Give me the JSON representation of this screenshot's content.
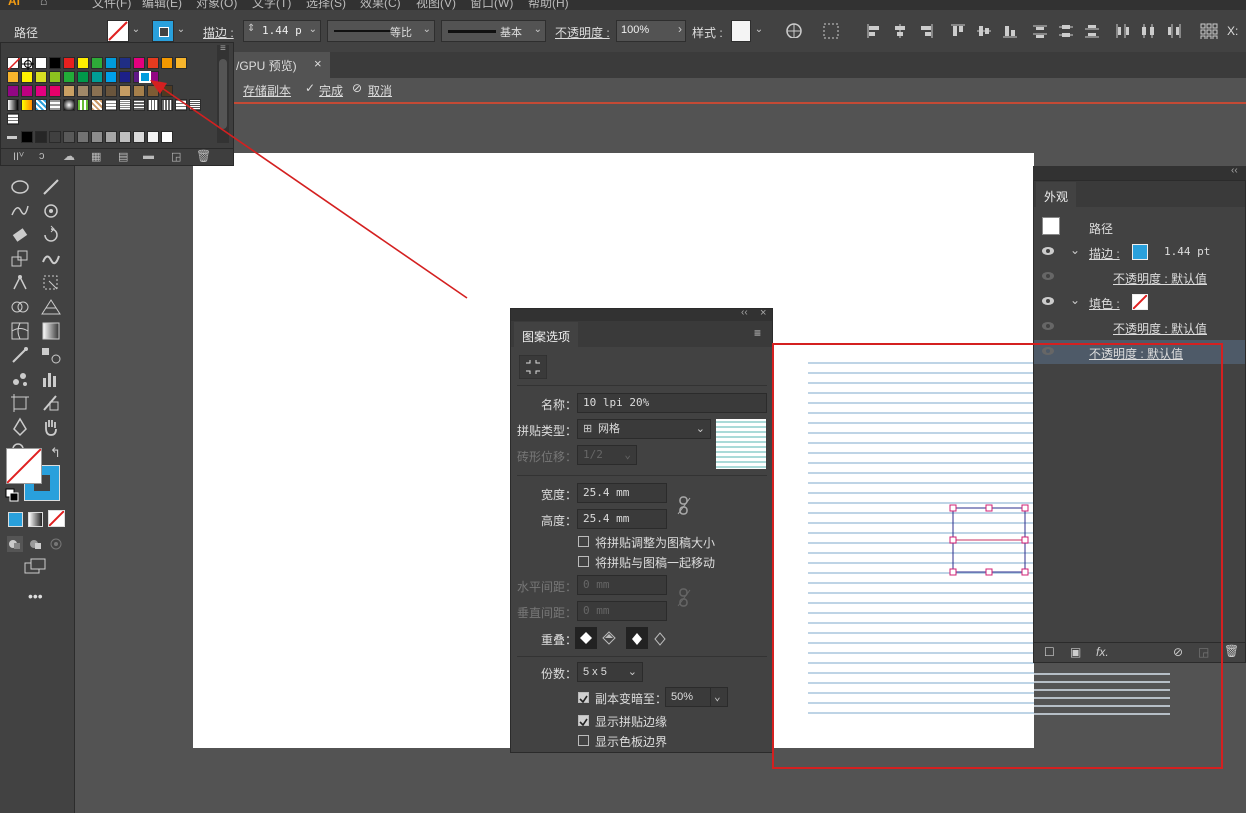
{
  "menubar": {
    "app_logo": "Ai",
    "items": [
      "文件(F)",
      "编辑(E)",
      "对象(O)",
      "文字(T)",
      "选择(S)",
      "效果(C)",
      "视图(V)",
      "窗口(W)",
      "帮助(H)"
    ]
  },
  "control_bar": {
    "selection_label": "路径",
    "stroke_label": "描边 :",
    "stroke_weight": "1.44 p",
    "profile_label": "等比",
    "brush_label": "基本",
    "opacity_label": "不透明度 :",
    "opacity_value": "100%",
    "style_label": "样式 :",
    "x_label": "X:"
  },
  "doc_tab": {
    "title": "/GPU 预览)",
    "close": "×"
  },
  "isolation_bar": {
    "save_copy": "存储副本",
    "done": "完成",
    "cancel": "取消",
    "check_glyph": "✓",
    "cancel_glyph": "⊘"
  },
  "swatches": {
    "colors_row1": [
      "#ffffff",
      "#000000",
      "#e8201f",
      "#ffed00",
      "#2eab38",
      "#009cdc",
      "#1f2e84",
      "#e5007e",
      "#e63b1f",
      "#f39800",
      "#f7b52c"
    ],
    "colors_row2": [
      "#f7b52c",
      "#fff100",
      "#d7df22",
      "#8dc21f",
      "#22ac38",
      "#00984a",
      "#009e96",
      "#00a0e9",
      "#1d2088",
      "#5f1985",
      "#920783"
    ],
    "colors_row3": [
      "#920783",
      "#be0081",
      "#e4007f",
      "#e5006a",
      "#c9a063",
      "#a08868",
      "#8a7152",
      "#6a553c",
      "#c59c63",
      "#a57f4b",
      "#7d5b34",
      "#4f3a22"
    ],
    "grays": [
      "#000000",
      "#262626",
      "#404040",
      "#595959",
      "#737373",
      "#8c8c8c",
      "#a6a6a6",
      "#bfbfbf",
      "#d9d9d9",
      "#f2f2f2",
      "#ffffff"
    ],
    "selected_color": "#009cdc"
  },
  "pattern_panel": {
    "title": "图案选项",
    "name_label": "名称：",
    "name_value": "10 lpi 20%",
    "tile_type_label": "拼贴类型：",
    "tile_type_value": "网格",
    "brick_offset_label": "砖形位移：",
    "brick_offset_value": "1/2",
    "width_label": "宽度：",
    "width_value": "25.4 mm",
    "height_label": "高度：",
    "height_value": "25.4 mm",
    "size_to_art": "将拼贴调整为图稿大小",
    "move_with_art": "将拼贴与图稿一起移动",
    "h_spacing_label": "水平间距：",
    "h_spacing_value": "0 mm",
    "v_spacing_label": "垂直间距：",
    "v_spacing_value": "0 mm",
    "overlap_label": "重叠：",
    "copies_label": "份数：",
    "copies_value": "5 x 5",
    "dim_copies_label": "副本变暗至：",
    "dim_copies_value": "50%",
    "show_tile_edge": "显示拼贴边缘",
    "show_swatch_bounds": "显示色板边界",
    "checks": {
      "size_to_art": false,
      "move_with_art": false,
      "dim_copies": true,
      "show_tile_edge": true,
      "show_swatch_bounds": false
    }
  },
  "appearance_panel": {
    "title": "外观",
    "object_label": "路径",
    "stroke_label": "描边 :",
    "stroke_value": "1.44 pt",
    "stroke_color": "#29a0dc",
    "opacity_default": "不透明度 : 默认值",
    "fill_label": "填色 :",
    "fx_label": "fx."
  },
  "colors": {
    "accent": "#c44a35",
    "annotation_red": "#d42020",
    "pattern_line": "#a9c6de",
    "tile_box": "#2b2d8c",
    "tile_handle": "#d21f73"
  }
}
